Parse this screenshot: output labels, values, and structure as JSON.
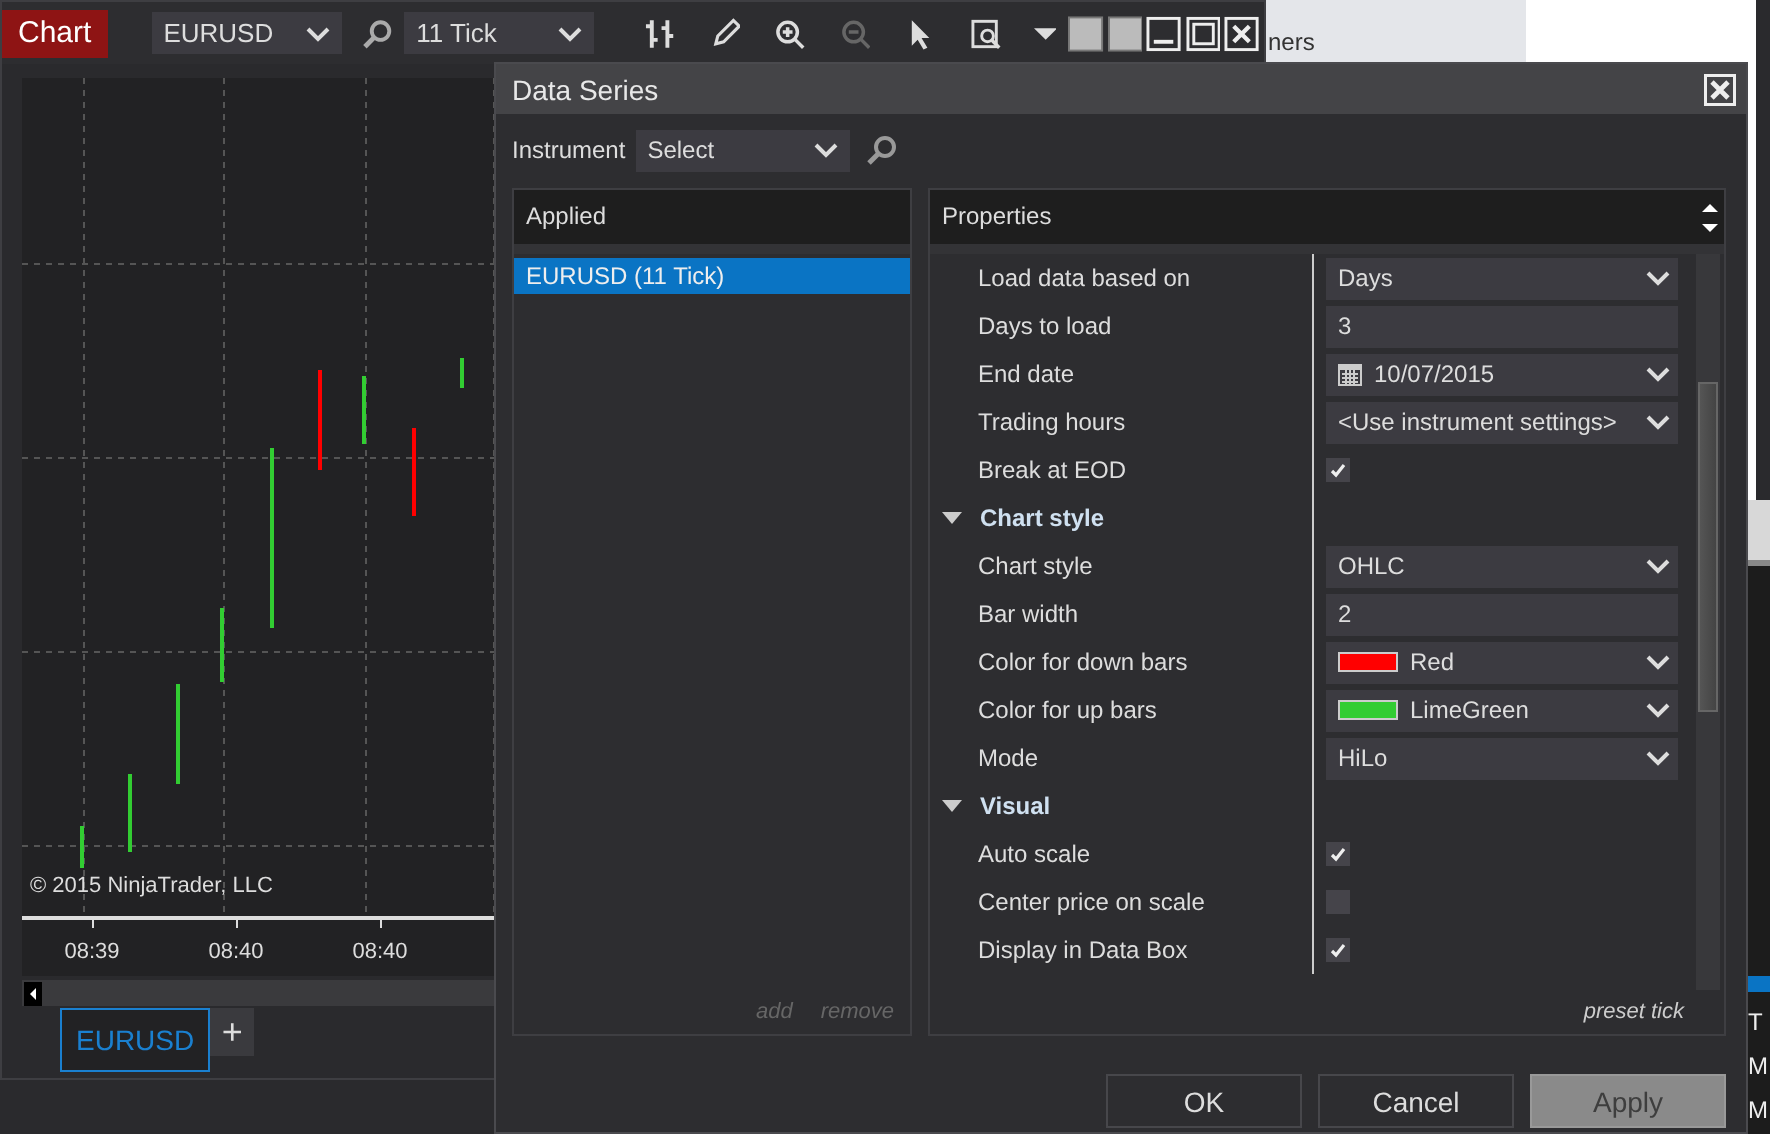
{
  "background": {
    "behind_text": "ners",
    "side_list": [
      {
        "label": "T",
        "selected": false
      },
      {
        "label": "M",
        "selected": false
      },
      {
        "label": "M",
        "selected": false
      }
    ]
  },
  "chart_window": {
    "tab": "Chart",
    "instrument": "EURUSD",
    "interval": "11 Tick",
    "copyright": "© 2015 NinjaTrader, LLC",
    "time_labels": [
      "08:39",
      "08:40",
      "08:40"
    ],
    "tabs": [
      {
        "label": "EURUSD",
        "selected": true
      }
    ],
    "add_tab": "+"
  },
  "dialog": {
    "title": "Data Series",
    "instrument_label": "Instrument",
    "instrument_placeholder": "Select",
    "applied": {
      "header": "Applied",
      "items": [
        {
          "label": "EURUSD (11 Tick)",
          "selected": true
        }
      ],
      "add": "add",
      "remove": "remove"
    },
    "properties": {
      "header": "Properties",
      "rows": [
        {
          "kind": "select",
          "label": "Load data based on",
          "value": "Days"
        },
        {
          "kind": "text",
          "label": "Days to load",
          "value": "3"
        },
        {
          "kind": "date",
          "label": "End date",
          "value": "10/07/2015"
        },
        {
          "kind": "select",
          "label": "Trading hours",
          "value": "<Use instrument settings>"
        },
        {
          "kind": "checkbox",
          "label": "Break at EOD",
          "checked": true
        },
        {
          "kind": "category",
          "label": "Chart style",
          "expanded": true
        },
        {
          "kind": "select",
          "label": "Chart style",
          "value": "OHLC"
        },
        {
          "kind": "text",
          "label": "Bar width",
          "value": "2"
        },
        {
          "kind": "color",
          "label": "Color for down bars",
          "value": "Red",
          "color": "#ff0000"
        },
        {
          "kind": "color",
          "label": "Color for up bars",
          "value": "LimeGreen",
          "color": "#32cd32"
        },
        {
          "kind": "select",
          "label": "Mode",
          "value": "HiLo"
        },
        {
          "kind": "category",
          "label": "Visual",
          "expanded": true
        },
        {
          "kind": "checkbox",
          "label": "Auto scale",
          "checked": true
        },
        {
          "kind": "checkbox",
          "label": "Center price on scale",
          "checked": false
        },
        {
          "kind": "checkbox",
          "label": "Display in Data Box",
          "checked": true
        }
      ],
      "preset": "preset tick"
    },
    "buttons": [
      {
        "label": "OK",
        "disabled": false
      },
      {
        "label": "Cancel",
        "disabled": false
      },
      {
        "label": "Apply",
        "disabled": true
      }
    ]
  }
}
